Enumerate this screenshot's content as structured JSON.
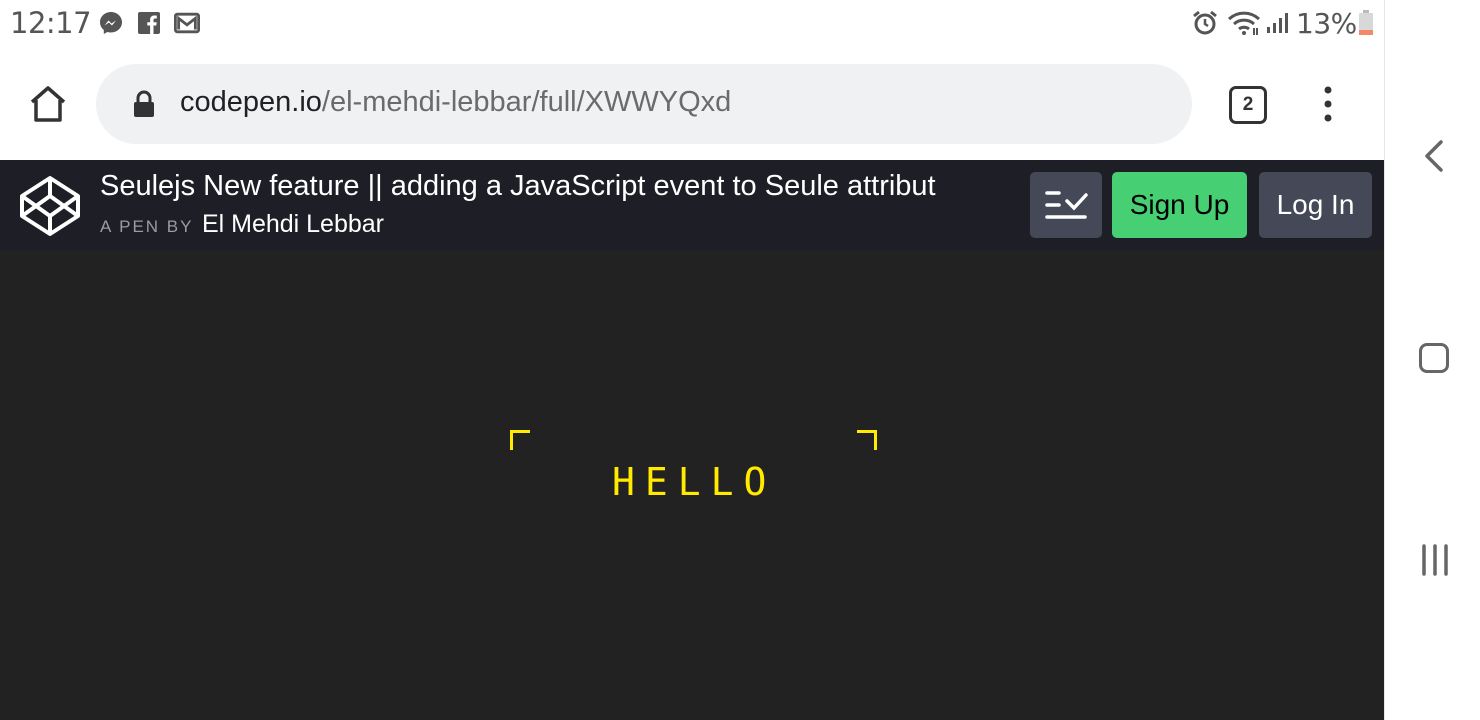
{
  "status_bar": {
    "time": "12:17",
    "notification_icons": [
      "messenger-icon",
      "facebook-icon",
      "gmail-icon"
    ],
    "system_icons": [
      "alarm-icon",
      "wifi-icon",
      "signal-icon",
      "battery-icon"
    ],
    "battery_percent": "13%"
  },
  "browser": {
    "url_domain": "codepen.io",
    "url_path": "/el-mehdi-lebbar/full/XWWYQxd",
    "tab_count": "2"
  },
  "codepen": {
    "title": "Seulejs New feature || adding a JavaScript event to Seule attribut",
    "by_label": "A PEN BY",
    "author": "El Mehdi Lebbar",
    "signup_label": "Sign Up",
    "login_label": "Log In"
  },
  "preview": {
    "text": "HELLO",
    "text_color": "#ffea00",
    "background": "#222222"
  },
  "colors": {
    "header_bg": "#1e1f26",
    "signup_bg": "#47cf73",
    "button_bg": "#444857"
  }
}
